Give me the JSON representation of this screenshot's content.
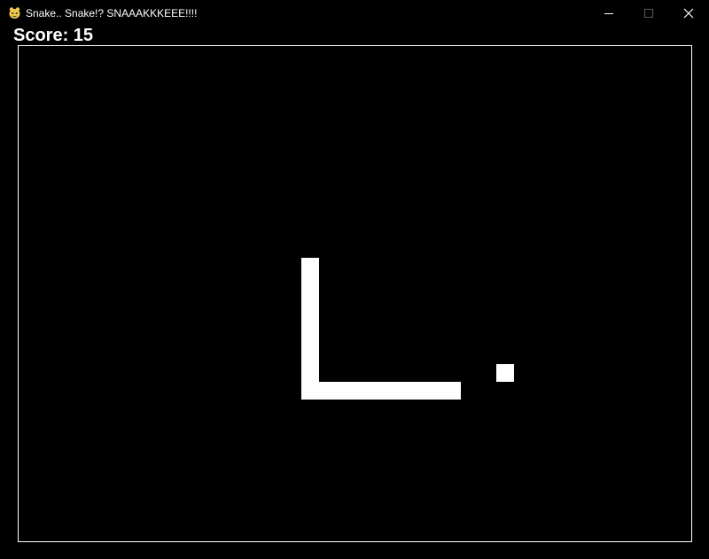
{
  "window": {
    "title": "Snake.. Snake!? SNAAAKKKEEE!!!!",
    "app_icon": "pygame-snake-icon",
    "controls": [
      "minimize-icon",
      "maximize-icon",
      "close-icon"
    ]
  },
  "game": {
    "score_text": "Score: 15",
    "score": 15,
    "colors": {
      "background": "#000000",
      "snake": "#ffffff",
      "food": "#ffffff",
      "border": "#ffffff",
      "text": "#ffffff"
    }
  }
}
